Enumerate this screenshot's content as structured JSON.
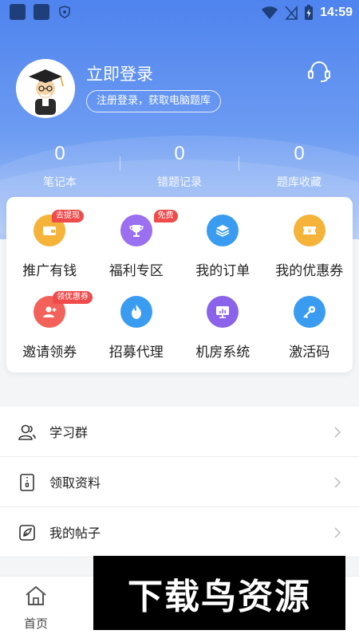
{
  "status_bar": {
    "time": "14:59"
  },
  "profile": {
    "title": "立即登录",
    "subtitle": "注册登录，获取电脑题库"
  },
  "stats": [
    {
      "value": "0",
      "label": "笔记本"
    },
    {
      "value": "0",
      "label": "错题记录"
    },
    {
      "value": "0",
      "label": "题库收藏"
    }
  ],
  "grid": [
    {
      "label": "推广有钱",
      "badge": "去提现",
      "icon": "wallet-icon",
      "color": "#f5b33a"
    },
    {
      "label": "福利专区",
      "badge": "免费",
      "icon": "trophy-icon",
      "color": "#9a6ff0"
    },
    {
      "label": "我的订单",
      "badge": "",
      "icon": "layers-icon",
      "color": "#3a9cf0"
    },
    {
      "label": "我的优惠券",
      "badge": "",
      "icon": "ticket-icon",
      "color": "#f5b33a"
    },
    {
      "label": "邀请领券",
      "badge": "领优惠券",
      "icon": "add-user-icon",
      "color": "#f2625a"
    },
    {
      "label": "招募代理",
      "badge": "",
      "icon": "flame-icon",
      "color": "#3a9cf0"
    },
    {
      "label": "机房系统",
      "badge": "",
      "icon": "monitor-icon",
      "color": "#8a63ea"
    },
    {
      "label": "激活码",
      "badge": "",
      "icon": "key-icon",
      "color": "#3a9cf0"
    }
  ],
  "list": [
    {
      "label": "学习群",
      "icon": "group-icon"
    },
    {
      "label": "领取资料",
      "icon": "document-icon"
    },
    {
      "label": "我的帖子",
      "icon": "post-icon"
    }
  ],
  "tabbar": {
    "home_label": "首页"
  },
  "watermark": {
    "text": "下载鸟资源"
  }
}
